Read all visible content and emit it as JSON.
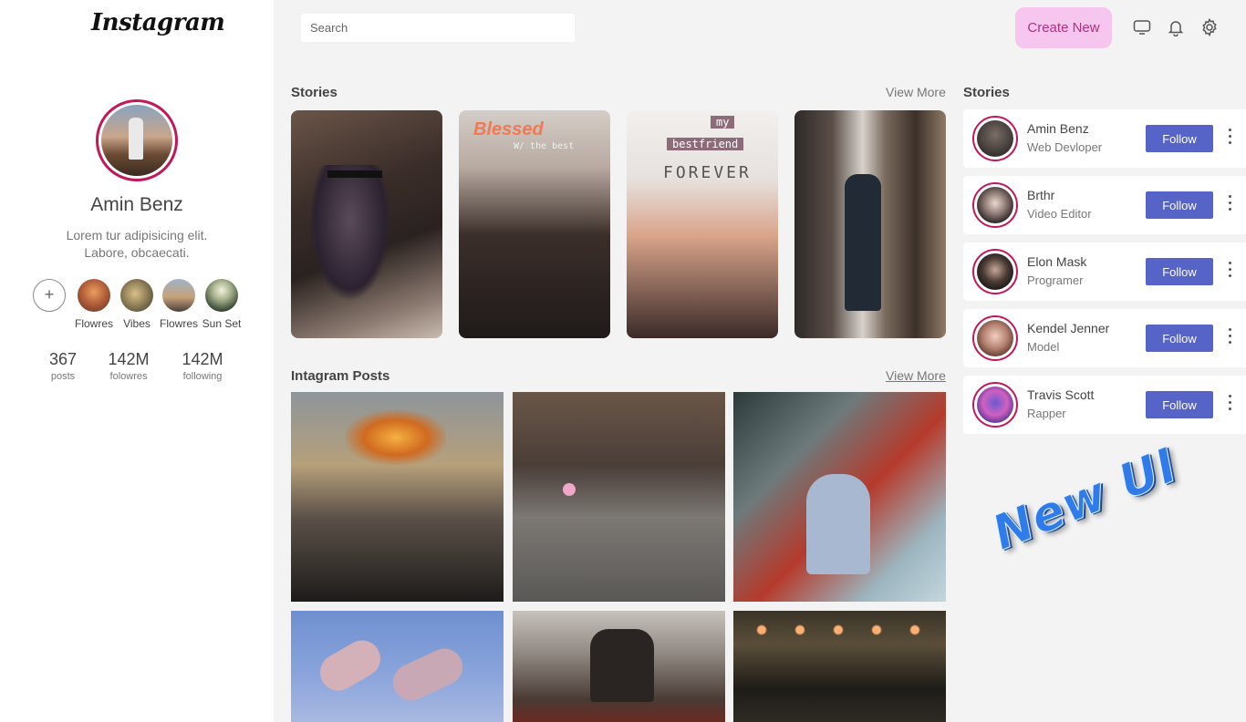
{
  "app": {
    "logo": "Instagram"
  },
  "profile": {
    "name": "Amin Benz",
    "bio_line1": "Lorem tur adipisicing elit.",
    "bio_line2": "Labore, obcaecati.",
    "add_symbol": "+",
    "highlights": [
      {
        "label": "Flowres",
        "color": "#b5603a"
      },
      {
        "label": "Vibes",
        "color": "#8a7a55"
      },
      {
        "label": "Flowres",
        "color": "#6e6a70"
      },
      {
        "label": "Sun Set",
        "color": "#2c3a2c"
      }
    ],
    "stats": [
      {
        "value": "367",
        "label": "posts"
      },
      {
        "value": "142M",
        "label": "folowres"
      },
      {
        "value": "142M",
        "label": "following"
      }
    ]
  },
  "header": {
    "search_placeholder": "Search",
    "create_label": "Create New",
    "icons": [
      "monitor-icon",
      "bell-icon",
      "gear-icon"
    ]
  },
  "stories_section": {
    "title": "Stories",
    "view_more": "View More",
    "story_captions": {
      "blessed": "Blessed",
      "with_best": "W/ the best",
      "my": "my",
      "bestfriend": "bestfriend",
      "forever": "FOREVER"
    }
  },
  "posts_section": {
    "title": "Intagram Posts",
    "view_more": "View More"
  },
  "suggestions": {
    "title": "Stories",
    "follow_label": "Follow",
    "people": [
      {
        "name": "Amin Benz",
        "role": "Web Devloper"
      },
      {
        "name": "Brthr",
        "role": "Video Editor"
      },
      {
        "name": "Elon Mask",
        "role": "Programer"
      },
      {
        "name": "Kendel Jenner",
        "role": "Model"
      },
      {
        "name": "Travis Scott",
        "role": "Rapper"
      }
    ]
  },
  "watermark": "New UI",
  "colors": {
    "accent_ring": "#c2185b",
    "follow_button": "#5663c7",
    "create_button_bg": "#f7c6ef",
    "create_button_text": "#b0317e"
  }
}
